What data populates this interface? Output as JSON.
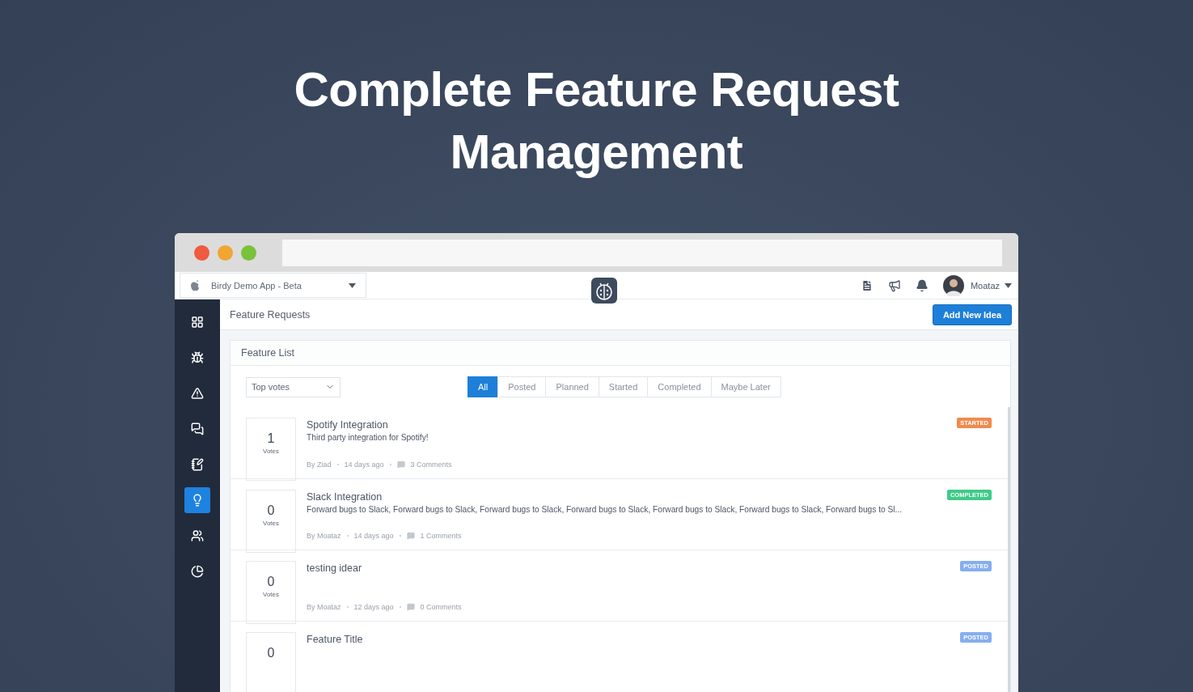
{
  "headline": [
    "Complete Feature Request",
    "Management"
  ],
  "app": {
    "project": "Birdy Demo App - Beta",
    "user": "Moataz"
  },
  "sidebar": {
    "items": [
      {
        "selected": false
      },
      {
        "selected": false
      },
      {
        "selected": false
      },
      {
        "selected": false
      },
      {
        "selected": false
      },
      {
        "selected": true
      },
      {
        "selected": false
      },
      {
        "selected": false
      }
    ]
  },
  "page": {
    "title": "Feature Requests",
    "primary_button": "Add New Idea"
  },
  "feature_list": {
    "title": "Feature List",
    "sort": "Top votes",
    "filters": [
      {
        "label": "All",
        "selected": true
      },
      {
        "label": "Posted",
        "selected": false
      },
      {
        "label": "Planned",
        "selected": false
      },
      {
        "label": "Started",
        "selected": false
      },
      {
        "label": "Completed",
        "selected": false
      },
      {
        "label": "Maybe Later",
        "selected": false
      }
    ],
    "items": [
      {
        "votes": "1",
        "votes_label": "Votes",
        "title": "Spotify Integration",
        "description": "Third party integration for Spotify!",
        "author": "By Ziad",
        "age": "14 days ago",
        "comments": "3 Comments",
        "status": "STARTED",
        "color": "#ef8b4f"
      },
      {
        "votes": "0",
        "votes_label": "Votes",
        "title": "Slack Integration",
        "description": "Forward bugs to Slack, Forward bugs to Slack, Forward bugs to Slack, Forward bugs to Slack, Forward bugs to Slack, Forward bugs to Slack, Forward bugs to Sl...",
        "author": "By Moataz",
        "age": "14 days ago",
        "comments": "1 Comments",
        "status": "COMPLETED",
        "color": "#3ecb87"
      },
      {
        "votes": "0",
        "votes_label": "Votes",
        "title": "testing idear",
        "author": "By Moataz",
        "age": "12 days ago",
        "comments": "0 Comments",
        "status": "POSTED",
        "color": "#86aef0"
      },
      {
        "votes": "0",
        "title": "Feature Title",
        "status": "POSTED",
        "color": "#86aef0"
      }
    ]
  }
}
